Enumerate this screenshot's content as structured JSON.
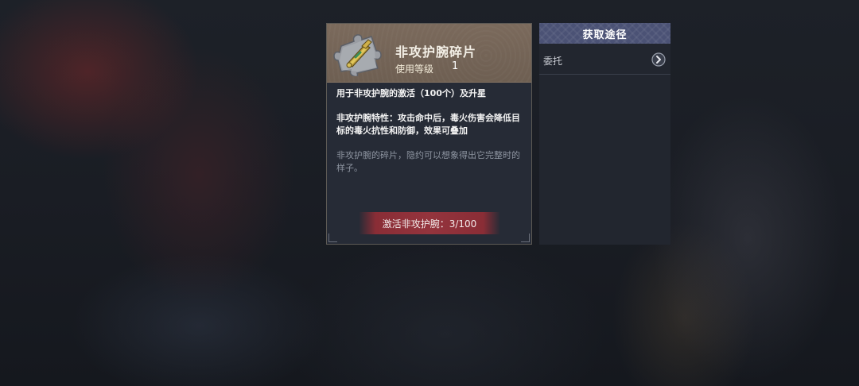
{
  "item": {
    "icon": "bracer-fragment-icon",
    "name": "非攻护腕碎片",
    "level_label": "使用等级",
    "level_value": "1",
    "usage": "用于非攻护腕的激活（100个）及升星",
    "trait": "非攻护腕特性：攻击命中后，毒火伤害会降低目标的毒火抗性和防御，效果可叠加",
    "flavor": "非攻护腕的碎片，隐约可以想象得出它完整时的样子。",
    "activate_progress": "激活非攻护腕：3/100"
  },
  "acquire": {
    "title": "获取途径",
    "sources": [
      {
        "label": "委托",
        "icon": "chevron-right-icon"
      }
    ]
  },
  "colors": {
    "header_brown": "#7b6a5c",
    "panel_dark": "#262b36",
    "acquire_header": "#4b5275",
    "activate_red": "#94343d"
  }
}
